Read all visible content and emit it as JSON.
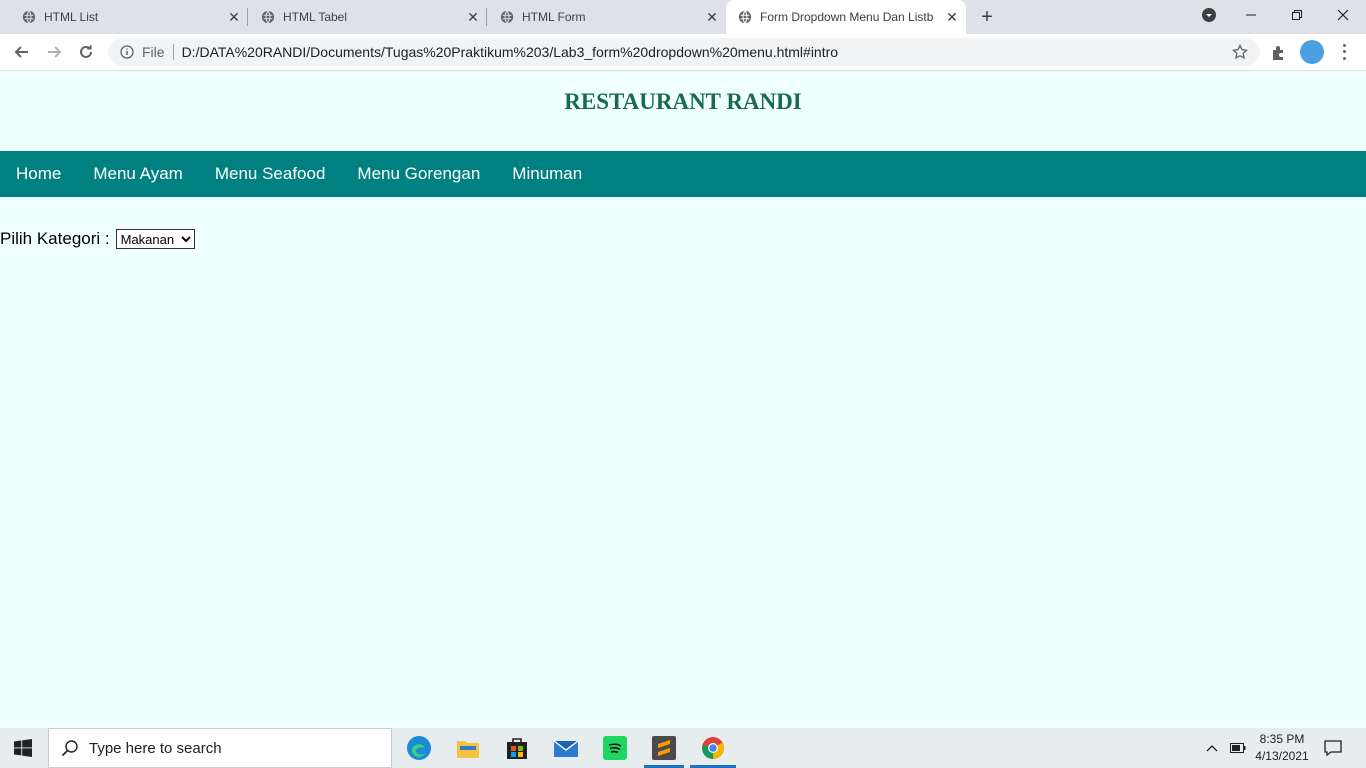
{
  "browser": {
    "tabs": [
      {
        "title": "HTML List",
        "active": false
      },
      {
        "title": "HTML Tabel",
        "active": false
      },
      {
        "title": "HTML Form",
        "active": false
      },
      {
        "title": "Form Dropdown Menu Dan Listb",
        "active": true
      }
    ],
    "omnibox": {
      "scheme_label": "File",
      "url": "D:/DATA%20RANDI/Documents/Tugas%20Praktikum%203/Lab3_form%20dropdown%20menu.html#intro"
    }
  },
  "page": {
    "title": "RESTAURANT RANDI",
    "nav": [
      "Home",
      "Menu Ayam",
      "Menu Seafood",
      "Menu Gorengan",
      "Minuman"
    ],
    "form": {
      "label": "Pilih Kategori :",
      "selected": "Makanan"
    }
  },
  "taskbar": {
    "search_placeholder": "Type here to search",
    "time": "8:35 PM",
    "date": "4/13/2021"
  },
  "colors": {
    "page_bg": "#f0ffff",
    "nav_bg": "#008080",
    "title": "#1a6b4a"
  }
}
